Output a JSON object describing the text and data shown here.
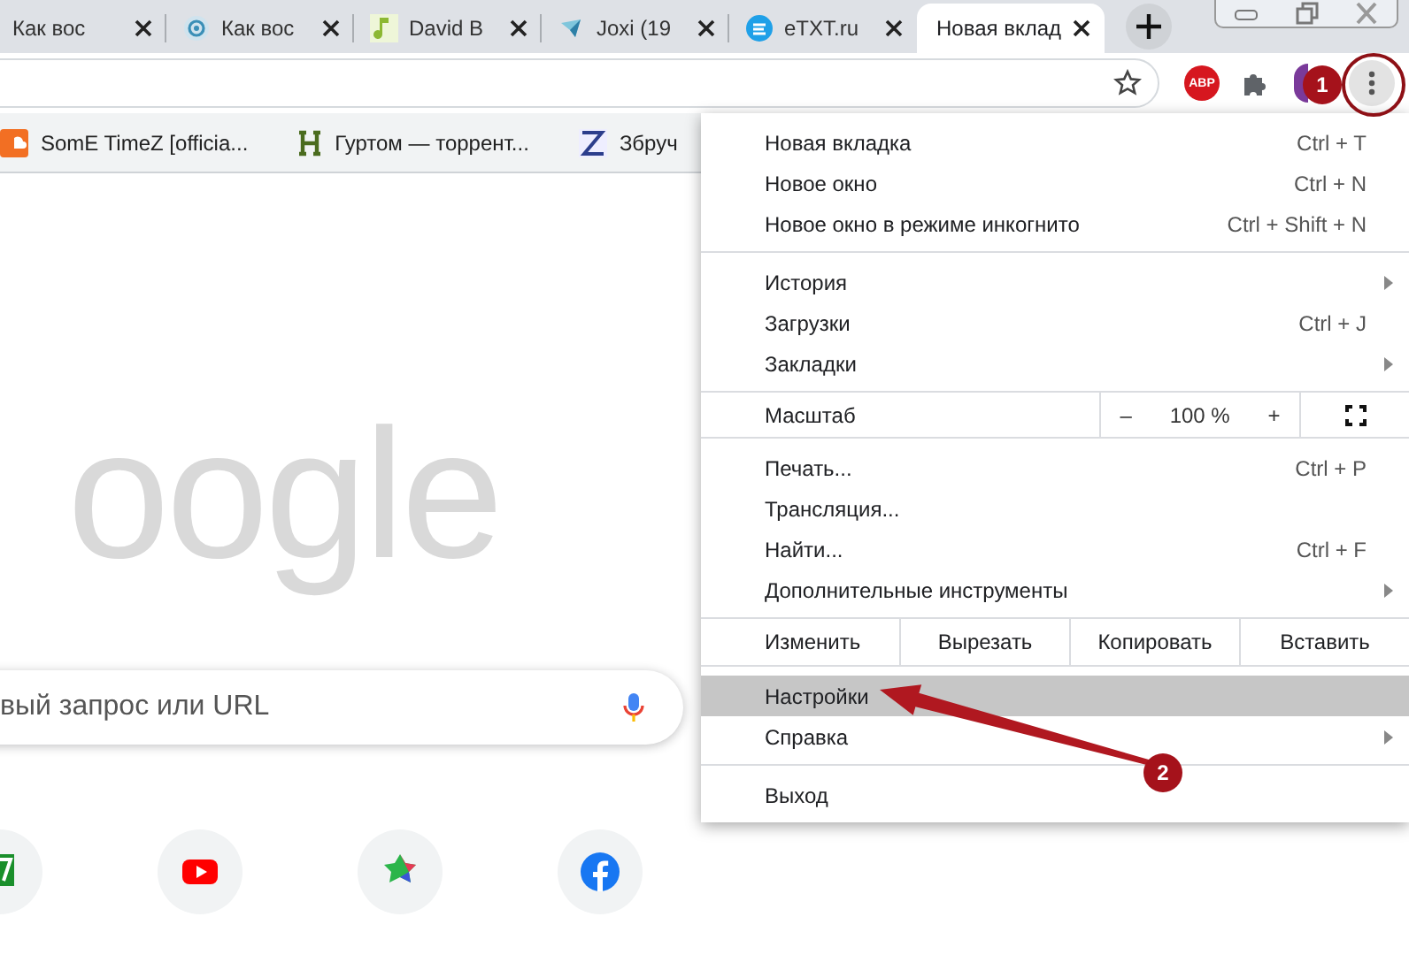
{
  "tabs": [
    {
      "title": "Как вос",
      "selected": false
    },
    {
      "title": "Как вос",
      "selected": false
    },
    {
      "title": "David B",
      "selected": false
    },
    {
      "title": "Joxi (19",
      "selected": false
    },
    {
      "title": "eTXT.ru",
      "selected": false
    },
    {
      "title": "Новая вклад",
      "selected": true
    }
  ],
  "toolbar": {
    "extension_badge": "ABP"
  },
  "bookmarks": [
    "SomE TimeZ [officia...",
    "Гуртом — торрент...",
    "Збруч"
  ],
  "new_tab_page": {
    "logo": "oogle",
    "search_placeholder": "вый запрос или URL"
  },
  "menu": {
    "sections": [
      {
        "items": [
          {
            "kind": "item",
            "label": "Новая вкладка",
            "shortcut": "Ctrl + T",
            "submenu": false,
            "selected": false
          },
          {
            "kind": "item",
            "label": "Новое окно",
            "shortcut": "Ctrl + N",
            "submenu": false,
            "selected": false
          },
          {
            "kind": "item",
            "label": "Новое окно в режиме инкогнито",
            "shortcut": "Ctrl + Shift + N",
            "submenu": false,
            "selected": false
          }
        ]
      },
      {
        "items": [
          {
            "kind": "item",
            "label": "История",
            "submenu": true,
            "selected": false
          },
          {
            "kind": "item",
            "label": "Загрузки",
            "shortcut": "Ctrl + J",
            "submenu": false,
            "selected": false
          },
          {
            "kind": "item",
            "label": "Закладки",
            "submenu": true,
            "selected": false
          }
        ]
      },
      {
        "items": [
          {
            "kind": "zoom",
            "label": "Масштаб",
            "minus": "–",
            "value": "100 %",
            "plus": "+"
          }
        ]
      },
      {
        "items": [
          {
            "kind": "item",
            "label": "Печать...",
            "shortcut": "Ctrl + P",
            "submenu": false,
            "selected": false
          },
          {
            "kind": "item",
            "label": "Трансляция...",
            "submenu": false,
            "selected": false
          },
          {
            "kind": "item",
            "label": "Найти...",
            "shortcut": "Ctrl + F",
            "submenu": false,
            "selected": false
          },
          {
            "kind": "item",
            "label": "Дополнительные инструменты",
            "submenu": true,
            "selected": false
          }
        ]
      },
      {
        "items": [
          {
            "kind": "edit",
            "label": "Изменить",
            "actions": [
              "Вырезать",
              "Копировать",
              "Вставить"
            ]
          }
        ]
      },
      {
        "items": [
          {
            "kind": "item",
            "label": "Настройки",
            "submenu": false,
            "selected": true
          },
          {
            "kind": "item",
            "label": "Справка",
            "submenu": true,
            "selected": false
          }
        ]
      },
      {
        "items": [
          {
            "kind": "item",
            "label": "Выход",
            "submenu": false,
            "selected": false
          }
        ]
      }
    ]
  },
  "annotations": [
    {
      "label": "1"
    },
    {
      "label": "2"
    }
  ]
}
